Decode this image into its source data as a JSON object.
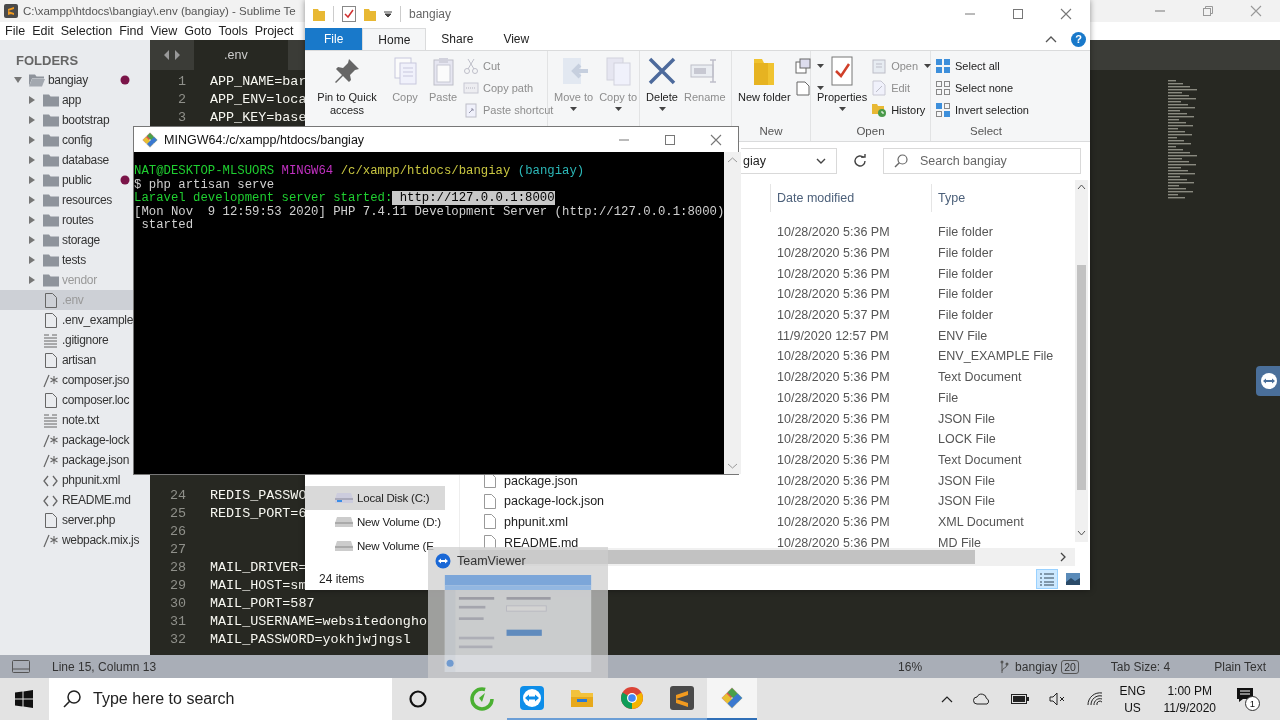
{
  "sublime": {
    "title": "C:\\xampp\\htdocs\\bangiay\\.env (bangiay) - Sublime Te",
    "menu": [
      "File",
      "Edit",
      "Selection",
      "Find",
      "View",
      "Goto",
      "Tools",
      "Project"
    ],
    "sidebar": {
      "heading": "FOLDERS",
      "tree": [
        {
          "label": "bangiay",
          "kind": "folder",
          "expanded": true,
          "modified": true,
          "selected": false,
          "dimmed": false,
          "children": [
            {
              "label": "app",
              "kind": "folder",
              "expanded": false,
              "modified": false,
              "selected": false,
              "dimmed": false
            },
            {
              "label": "bootstrap",
              "kind": "folder",
              "expanded": false,
              "modified": false,
              "selected": false,
              "dimmed": false
            },
            {
              "label": "config",
              "kind": "folder",
              "expanded": false,
              "modified": false,
              "selected": false,
              "dimmed": false
            },
            {
              "label": "database",
              "kind": "folder",
              "expanded": false,
              "modified": false,
              "selected": false,
              "dimmed": false
            },
            {
              "label": "public",
              "kind": "folder",
              "expanded": false,
              "modified": true,
              "selected": false,
              "dimmed": false
            },
            {
              "label": "resources",
              "kind": "folder",
              "expanded": false,
              "modified": false,
              "selected": false,
              "dimmed": false
            },
            {
              "label": "routes",
              "kind": "folder",
              "expanded": false,
              "modified": false,
              "selected": false,
              "dimmed": false
            },
            {
              "label": "storage",
              "kind": "folder",
              "expanded": false,
              "modified": false,
              "selected": false,
              "dimmed": false
            },
            {
              "label": "tests",
              "kind": "folder",
              "expanded": false,
              "modified": false,
              "selected": false,
              "dimmed": false
            },
            {
              "label": "vendor",
              "kind": "folder",
              "expanded": false,
              "modified": false,
              "selected": false,
              "dimmed": true
            },
            {
              "label": ".env",
              "kind": "file",
              "modified": false,
              "selected": true,
              "dimmed": true
            },
            {
              "label": ".env_example",
              "kind": "file",
              "modified": false,
              "selected": false,
              "dimmed": false
            },
            {
              "label": ".gitignore",
              "kind": "text",
              "modified": false,
              "selected": false,
              "dimmed": false
            },
            {
              "label": "artisan",
              "kind": "file",
              "modified": false,
              "selected": false,
              "dimmed": false
            },
            {
              "label": "composer.jso",
              "kind": "code",
              "modified": false,
              "selected": false,
              "dimmed": false
            },
            {
              "label": "composer.loc",
              "kind": "file",
              "modified": false,
              "selected": false,
              "dimmed": false
            },
            {
              "label": "note.txt",
              "kind": "text",
              "modified": false,
              "selected": false,
              "dimmed": false
            },
            {
              "label": "package-lock",
              "kind": "code",
              "modified": false,
              "selected": false,
              "dimmed": false
            },
            {
              "label": "package.json",
              "kind": "code",
              "modified": false,
              "selected": false,
              "dimmed": false
            },
            {
              "label": "phpunit.xml",
              "kind": "markup",
              "modified": false,
              "selected": false,
              "dimmed": false
            },
            {
              "label": "README.md",
              "kind": "markup",
              "modified": false,
              "selected": false,
              "dimmed": false
            },
            {
              "label": "server.php",
              "kind": "file",
              "modified": false,
              "selected": false,
              "dimmed": false
            },
            {
              "label": "webpack.mix.js",
              "kind": "code",
              "modified": false,
              "selected": false,
              "dimmed": false
            }
          ]
        }
      ]
    },
    "tab": ".env",
    "lines_top": [
      {
        "number": "1",
        "text": "APP_NAME=bar"
      },
      {
        "number": "2",
        "text": "APP_ENV=loca"
      },
      {
        "number": "3",
        "text": "APP_KEY=base"
      }
    ],
    "lines_bottom": [
      {
        "number": "24",
        "text": "REDIS_PASSWO"
      },
      {
        "number": "25",
        "text": "REDIS_PORT=6"
      },
      {
        "number": "26"
      },
      {
        "number": "27"
      },
      {
        "number": "28",
        "text": "MAIL_DRIVER="
      },
      {
        "number": "29",
        "text": "MAIL_HOST=sm"
      },
      {
        "number": "30",
        "text": "MAIL_PORT=587"
      },
      {
        "number": "31",
        "text": "MAIL_USERNAME=websitedongho"
      },
      {
        "number": "32",
        "text": "MAIL_PASSWORD=yokhjwjngsl"
      }
    ],
    "status": {
      "position": "Line 15, Column 13",
      "zoom": "16%",
      "branch": "bangiay",
      "changes": "20",
      "tab_size": "Tab Size: 4",
      "syntax": "Plain Text"
    }
  },
  "explorer": {
    "title": "bangiay",
    "tabs": [
      {
        "label": "File",
        "kind": "file",
        "selected": false
      },
      {
        "label": "Home",
        "kind": "tab",
        "selected": true
      },
      {
        "label": "Share",
        "kind": "tab",
        "selected": false
      },
      {
        "label": "View",
        "kind": "tab",
        "selected": false
      }
    ],
    "help": "?",
    "groups": [
      {
        "buttons": [
          {
            "label": "Pin to Quick access",
            "kind": "pin",
            "large": true,
            "disabled": false,
            "dropdown": false
          },
          {
            "label": "Copy",
            "kind": "copy",
            "large": true,
            "disabled": true,
            "dropdown": false
          },
          {
            "label": "Paste",
            "kind": "paste",
            "large": true,
            "disabled": true,
            "dropdown": false
          },
          {
            "label": "Cut",
            "kind": "cut",
            "large": false,
            "disabled": true,
            "dropdown": false
          },
          {
            "label": "Copy path",
            "kind": "copy-path",
            "large": false,
            "disabled": true,
            "dropdown": false
          },
          {
            "label": "Paste shortcut",
            "kind": "paste-shortcut",
            "large": false,
            "disabled": true,
            "dropdown": false
          }
        ]
      },
      {
        "buttons": [
          {
            "label": "Move to",
            "kind": "move",
            "large": true,
            "disabled": true,
            "dropdown": true
          },
          {
            "label": "Copy to",
            "kind": "copy-to",
            "large": true,
            "disabled": true,
            "dropdown": true
          }
        ]
      },
      {
        "buttons": [
          {
            "label": "Delete",
            "kind": "delete",
            "large": true,
            "disabled": false,
            "dropdown": true
          },
          {
            "label": "Rename",
            "kind": "rename",
            "large": true,
            "disabled": true,
            "dropdown": false
          }
        ]
      },
      {
        "label": "New",
        "buttons": [
          {
            "label": "New folder",
            "kind": "new-folder",
            "large": true,
            "disabled": false,
            "dropdown": false
          },
          {
            "kind": "new-item",
            "large": false,
            "disabled": false,
            "dropdown": true
          },
          {
            "kind": "easy-access",
            "large": false,
            "disabled": false,
            "dropdown": true
          }
        ]
      },
      {
        "label": "Open",
        "buttons": [
          {
            "label": "Properties",
            "kind": "properties",
            "large": true,
            "disabled": false,
            "dropdown": true
          },
          {
            "label": "Open",
            "kind": "open",
            "large": false,
            "disabled": true,
            "dropdown": true
          },
          {
            "label": "Edit",
            "kind": "edit",
            "large": false,
            "disabled": true,
            "dropdown": false
          },
          {
            "label": "History",
            "kind": "history",
            "large": false,
            "disabled": false,
            "dropdown": false
          }
        ]
      },
      {
        "label": "Select",
        "buttons": [
          {
            "label": "Select all",
            "kind": "select-all",
            "large": false,
            "disabled": false,
            "dropdown": false
          },
          {
            "label": "Select none",
            "kind": "select-none",
            "large": false,
            "disabled": false,
            "dropdown": false
          },
          {
            "label": "Invert selection",
            "kind": "invert",
            "large": false,
            "disabled": false,
            "dropdown": false
          }
        ]
      }
    ],
    "address": "giay",
    "search": {
      "placeholder": "Search bangiay"
    },
    "nav": [
      {
        "label": "Local Disk (C:)",
        "kind": "disk",
        "selected": true
      },
      {
        "label": "New Volume (D:)",
        "kind": "drive",
        "selected": false
      },
      {
        "label": "New Volume (E",
        "kind": "drive",
        "selected": false
      }
    ],
    "columns": [
      "Date modified",
      "Type"
    ],
    "rows": [
      {
        "date": "10/28/2020 5:36 PM",
        "type": "File folder"
      },
      {
        "date": "10/28/2020 5:36 PM",
        "type": "File folder"
      },
      {
        "date": "10/28/2020 5:36 PM",
        "type": "File folder"
      },
      {
        "date": "10/28/2020 5:36 PM",
        "type": "File folder"
      },
      {
        "date": "10/28/2020 5:37 PM",
        "type": "File folder"
      },
      {
        "date": "11/9/2020 12:57 PM",
        "type": "ENV File"
      },
      {
        "date": "10/28/2020 5:36 PM",
        "type": "ENV_EXAMPLE File"
      },
      {
        "date": "10/28/2020 5:36 PM",
        "type": "Text Document"
      },
      {
        "date": "10/28/2020 5:36 PM",
        "type": "File"
      },
      {
        "date": "10/28/2020 5:36 PM",
        "type": "JSON File"
      },
      {
        "date": "10/28/2020 5:36 PM",
        "type": "LOCK File"
      },
      {
        "date": "10/28/2020 5:36 PM",
        "type": "Text Document"
      },
      {
        "name": "package.json",
        "date": "10/28/2020 5:36 PM",
        "type": "JSON File"
      },
      {
        "name": "package-lock.json",
        "date": "10/28/2020 5:36 PM",
        "type": "JSON File"
      },
      {
        "name": "phpunit.xml",
        "date": "10/28/2020 5:36 PM",
        "type": "XML Document"
      },
      {
        "name": "README.md",
        "date": "10/28/2020 5:36 PM",
        "type": "MD File"
      }
    ],
    "item_count": "24 items",
    "views": [
      {
        "kind": "details",
        "selected": true
      },
      {
        "kind": "large",
        "selected": false
      }
    ]
  },
  "terminal": {
    "title": "MINGW64:/c/xampp/htdocs/bangiay",
    "lines": [
      [
        {
          "text": "NAT@DESKTOP-MLSUORS",
          "kind": "user"
        },
        {
          "text": " MINGW64",
          "kind": "host"
        },
        {
          "text": " /c/xampp/htdocs/bangiay",
          "kind": "path"
        },
        {
          "text": " (bangiay)",
          "kind": "branch"
        }
      ],
      [
        {
          "text": "$ php artisan serve",
          "kind": "plain"
        }
      ],
      [
        {
          "text": "Laravel development server started:",
          "kind": "success"
        },
        {
          "text": " http://127.0.0.1:8000",
          "kind": "highlight"
        }
      ],
      [
        {
          "text": "[Mon Nov  9 12:59:53 2020] PHP 7.4.11 Development Server (http://127.0.0.1:8000)",
          "kind": "plain"
        }
      ],
      [
        {
          "text": " started",
          "kind": "plain"
        }
      ]
    ]
  },
  "preview": {
    "title": "TeamViewer"
  },
  "taskbar": {
    "search": {
      "placeholder": "Type here to search"
    },
    "apps": [
      {
        "kind": "coccoc",
        "running": false,
        "active": false
      },
      {
        "kind": "teamviewer",
        "running": true,
        "active": false
      },
      {
        "kind": "explorer",
        "running": true,
        "active": false
      },
      {
        "kind": "chrome",
        "running": true,
        "active": false
      },
      {
        "kind": "sublime",
        "running": true,
        "active": false
      },
      {
        "kind": "git",
        "running": true,
        "active": true
      }
    ],
    "language": "ENG",
    "region": "US",
    "time": "1:00 PM",
    "date": "11/9/2020",
    "notifications": "1"
  }
}
